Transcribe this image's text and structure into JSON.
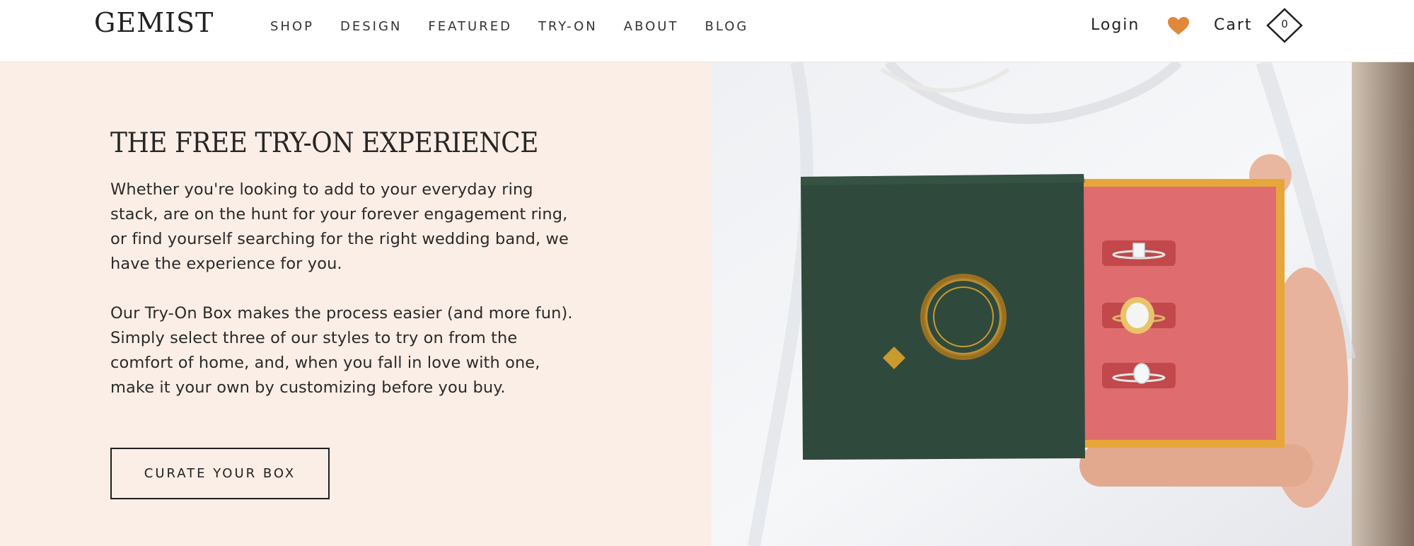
{
  "brand": {
    "logo": "GEMIST",
    "accent": "#e0893a"
  },
  "nav": [
    {
      "label": "SHOP"
    },
    {
      "label": "DESIGN"
    },
    {
      "label": "FEATURED"
    },
    {
      "label": "TRY-ON"
    },
    {
      "label": "ABOUT"
    },
    {
      "label": "BLOG"
    }
  ],
  "header": {
    "login": "Login",
    "favorites_icon": "heart-icon",
    "cart_label": "Cart",
    "cart_count": "0",
    "cart_icon": "diamond-icon"
  },
  "hero": {
    "title": "THE FREE TRY-ON EXPERIENCE",
    "paragraph1": "Whether you're looking to add to your everyday ring stack, are on the hunt for your forever engagement ring, or find yourself searching for the right wedding band, we have the experience for you.",
    "paragraph2": "Our Try-On Box makes the process easier (and more fun). Simply select three of our styles to try on from the comfort of home, and, when you fall in love with one, make it your own by customizing before you buy.",
    "cta": "CURATE YOUR BOX",
    "background": "#fbeee6"
  },
  "photo": {
    "box_color": "#2f4a3c",
    "tray_color": "#e06a6c",
    "gold": "#c99a2e"
  }
}
